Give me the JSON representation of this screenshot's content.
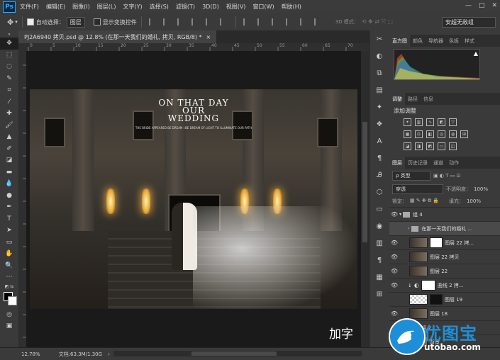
{
  "app": {
    "logo": "Ps"
  },
  "menu": [
    "文件(F)",
    "编辑(E)",
    "图像(I)",
    "图层(L)",
    "文字(Y)",
    "选择(S)",
    "滤镜(T)",
    "3D(D)",
    "视图(V)",
    "窗口(W)",
    "帮助(H)"
  ],
  "window_controls": [
    "—",
    "□",
    "✕"
  ],
  "options": {
    "auto_select_label": "自动选择：",
    "auto_select_value": "图层",
    "transform_label": "显示变换控件",
    "mode_3d": "3D 模式：",
    "workspace": "安超无敌组"
  },
  "document": {
    "tab_title": "PJ2A6940 拷贝.psd @ 12.8% (在那一天我们的婚礼, 拷贝, RGB/8) *",
    "close": "×"
  },
  "ruler_top": [
    "0",
    "5",
    "10",
    "15",
    "20",
    "25",
    "30",
    "35",
    "40",
    "45",
    "50",
    "55",
    "60",
    "65",
    "70"
  ],
  "photo": {
    "title_lines": [
      "ON THAT DAY",
      "OUR",
      "WEDDING"
    ],
    "subtitle": "THE BRIDE APPEARED BE DREAM I BE DREAM OF LIGHT TO ILLUMINATE OUR PATH"
  },
  "overlay_text": "加字",
  "panels": {
    "top_tabs": [
      "直方图",
      "颜色",
      "导航器",
      "色板",
      "样式"
    ],
    "adj_tabs": [
      "调整",
      "路径",
      "信息"
    ],
    "adj_title": "添加调整",
    "layer_tabs": [
      "图层",
      "历史记录",
      "通道",
      "动作"
    ],
    "filter_kind": "ρ 类型",
    "blend_mode": "穿透",
    "opacity_label": "不透明度：",
    "opacity_value": "100%",
    "lock_label": "锁定：",
    "fill_label": "填充：",
    "fill_value": "100%",
    "layers": [
      {
        "name": "组 4",
        "kind": "folder"
      },
      {
        "name": "在那一天我们的婚礼 ...",
        "kind": "folder"
      },
      {
        "name": "图层 22 拷...",
        "kind": "photo-mask"
      },
      {
        "name": "图层 22 拷贝",
        "kind": "photo"
      },
      {
        "name": "图层 22",
        "kind": "photo"
      },
      {
        "name": "曲线 2 拷...",
        "kind": "adjust"
      },
      {
        "name": "图层 19",
        "kind": "checker"
      },
      {
        "name": "图层 18",
        "kind": "photo"
      },
      {
        "name": "组 2",
        "kind": "folder"
      },
      {
        "name": "背景",
        "kind": "photo"
      }
    ]
  },
  "status": {
    "zoom": "12.78%",
    "doc": "文档:63.3M/1.30G"
  },
  "watermark": {
    "text": "优图宝",
    "url": "utobao.com"
  },
  "colors": {
    "accent": "#31a8ff",
    "watermark": "#1d8fd8"
  }
}
